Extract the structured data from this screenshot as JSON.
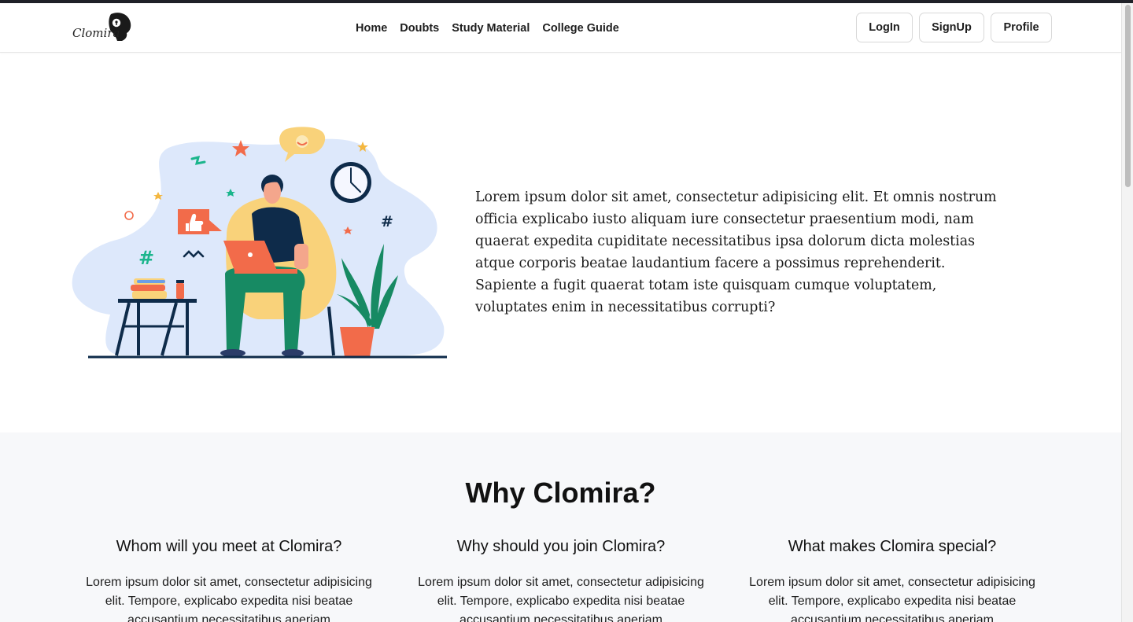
{
  "navbar": {
    "logo_text": "Clomira",
    "links": [
      "Home",
      "Doubts",
      "Study Material",
      "College Guide"
    ],
    "login_label": "LogIn",
    "signup_label": "SignUp",
    "profile_label": "Profile"
  },
  "hero": {
    "paragraph": "Lorem ipsum dolor sit amet, consectetur adipisicing elit. Et omnis nostrum officia explicabo iusto aliquam iure consectetur praesentium modi, nam quaerat expedita cupiditate necessitatibus ipsa dolorum dicta molestias atque corporis beatae laudantium facere a possimus reprehenderit. Sapiente a fugit quaerat totam iste quisquam cumque voluptatem, voluptates enim in necessitatibus corrupti?"
  },
  "why": {
    "title": "Why Clomira?",
    "columns": [
      {
        "heading": "Whom will you meet at Clomira?",
        "text": "Lorem ipsum dolor sit amet, consectetur adipisicing elit. Tempore, explicabo expedita nisi beatae accusantium necessitatibus aperiam"
      },
      {
        "heading": "Why should you join Clomira?",
        "text": "Lorem ipsum dolor sit amet, consectetur adipisicing elit. Tempore, explicabo expedita nisi beatae accusantium necessitatibus aperiam"
      },
      {
        "heading": "What makes Clomira special?",
        "text": "Lorem ipsum dolor sit amet, consectetur adipisicing elit. Tempore, explicabo expedita nisi beatae accusantium necessitatibus aperiam"
      }
    ]
  },
  "colors": {
    "accent_orange": "#f26b4a",
    "blob_blue": "#dde8fb",
    "chair_yellow": "#f9d27a",
    "pants_green": "#178a63",
    "navy": "#0e2b4a"
  }
}
